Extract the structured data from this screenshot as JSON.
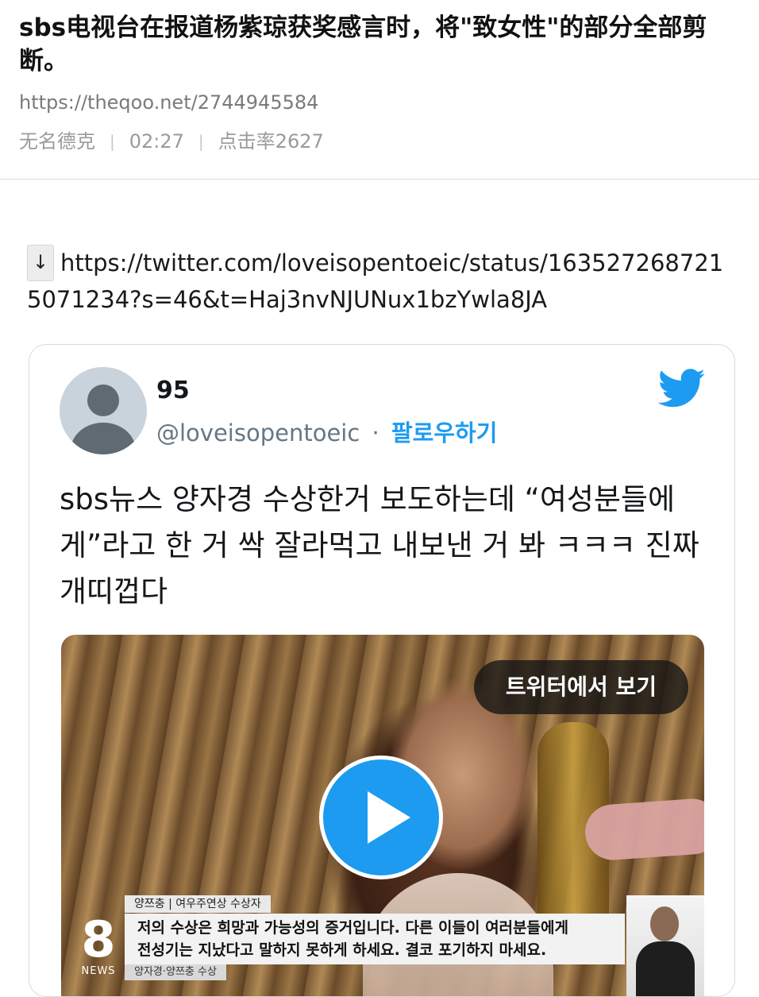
{
  "post": {
    "title": "sbs电视台在报道杨紫琼获奖感言时，将\"致女性\"的部分全部剪断。",
    "source_url": "https://theqoo.net/2744945584",
    "author": "无名德克",
    "time": "02:27",
    "views": "点击率2627"
  },
  "link": {
    "arrow": "↓",
    "url": "https://twitter.com/loveisopentoeic/status/1635272687215071234?s=46&t=Haj3nvNJUNux1bzYwla8JA"
  },
  "tweet": {
    "display_name": "95",
    "handle": "@loveisopentoeic",
    "separator": "·",
    "follow_label": "팔로우하기",
    "text": "sbs뉴스 양자경 수상한거 보도하는데 “여성분들에게”라고 한 거 싹 잘라먹고 내보낸 거 봐 ㅋㅋㅋ 진짜 개띠껍다",
    "view_on_twitter_label": "트위터에서 보기"
  },
  "video": {
    "news_label": "양쯔충  |  여우주연상 수상자",
    "subtitle_line1": "저의 수상은 희망과 가능성의 증거입니다. 다른 이들이 여러분들에게",
    "subtitle_line2": "전성기는 지났다고 말하지 못하게 하세요. 결코 포기하지 마세요.",
    "bottom_label": "양자경·양쯔충 수상",
    "channel_number": "8",
    "channel_text": "NEWS"
  },
  "colors": {
    "twitter_blue": "#1d9bf0",
    "meta_gray": "#9a9a9a"
  },
  "icons": {
    "bird": "twitter-bird-icon",
    "play": "play-icon",
    "arrow": "arrow-down-icon"
  }
}
